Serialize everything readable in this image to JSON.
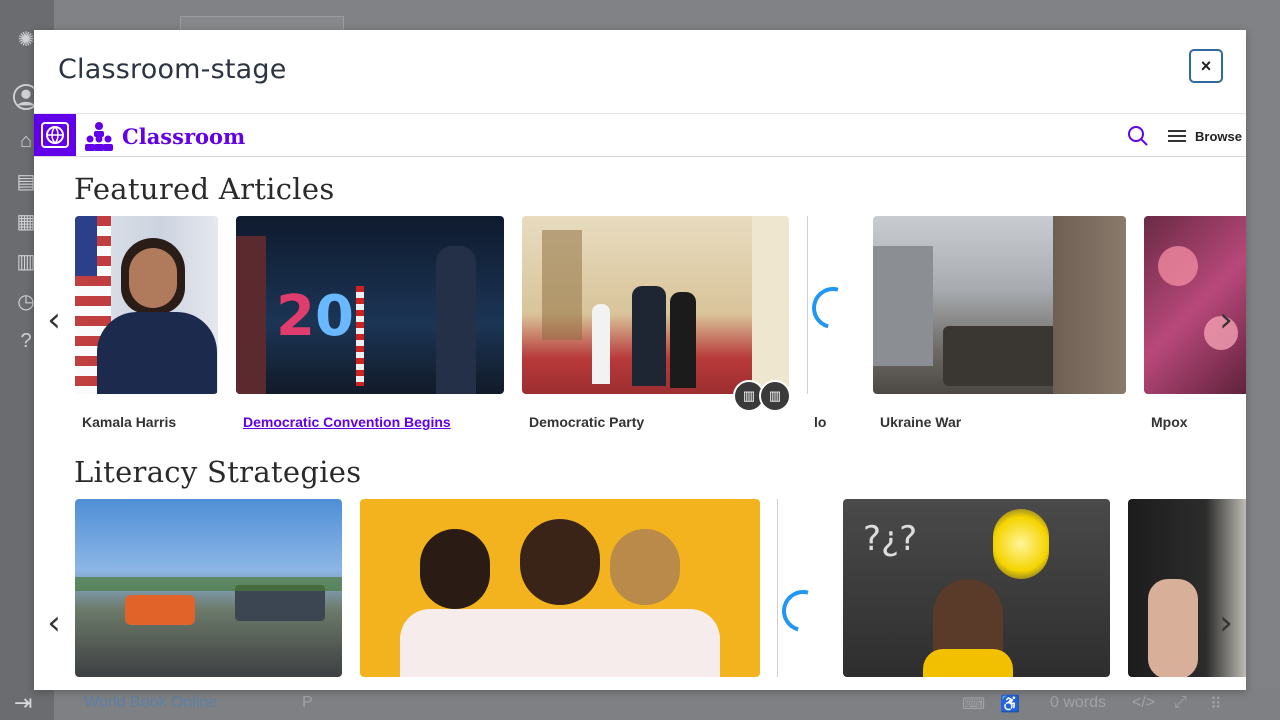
{
  "app": {
    "bottom_bar": {
      "product": "World Book Online",
      "paragraph": "P",
      "word_count": "0 words",
      "code_icon": "</>"
    }
  },
  "modal": {
    "title": "Classroom-stage",
    "close_label": "×"
  },
  "site": {
    "brand": "Classroom",
    "browse_label": "Browse",
    "accent_color": "#6200ea",
    "sections": [
      {
        "heading": "Featured Articles",
        "cards": [
          {
            "label": "Kamala Harris"
          },
          {
            "label": "Democratic Convention Begins"
          },
          {
            "label": "Democratic Party"
          },
          {
            "label": "lo"
          },
          {
            "label": "Ukraine War"
          },
          {
            "label": "Mpox"
          }
        ]
      },
      {
        "heading": "Literacy Strategies",
        "cards": []
      }
    ]
  }
}
